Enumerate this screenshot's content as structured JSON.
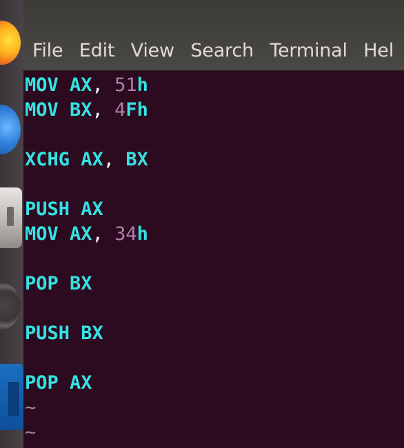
{
  "menu": [
    "File",
    "Edit",
    "View",
    "Search",
    "Terminal",
    "Hel"
  ],
  "lines": [
    {
      "op": "MOV AX",
      "sep": ",",
      "num": "51",
      "suf": "h"
    },
    {
      "op": "MOV BX",
      "sep": ",",
      "num": "4",
      "suf": "Fh"
    },
    {
      "op": "",
      "sep": "",
      "num": "",
      "suf": ""
    },
    {
      "op": "XCHG AX",
      "sep": ",",
      "num": "",
      "suf": "BX"
    },
    {
      "op": "",
      "sep": "",
      "num": "",
      "suf": ""
    },
    {
      "op": "PUSH AX",
      "sep": "",
      "num": "",
      "suf": ""
    },
    {
      "op": "MOV AX",
      "sep": ",",
      "num": "34",
      "suf": "h"
    },
    {
      "op": "",
      "sep": "",
      "num": "",
      "suf": ""
    },
    {
      "op": "POP BX",
      "sep": "",
      "num": "",
      "suf": ""
    },
    {
      "op": "",
      "sep": "",
      "num": "",
      "suf": ""
    },
    {
      "op": "PUSH BX",
      "sep": "",
      "num": "",
      "suf": ""
    },
    {
      "op": "",
      "sep": "",
      "num": "",
      "suf": ""
    },
    {
      "op": "POP AX",
      "sep": "",
      "num": "",
      "suf": ""
    }
  ],
  "tildes": [
    "~",
    "~"
  ]
}
